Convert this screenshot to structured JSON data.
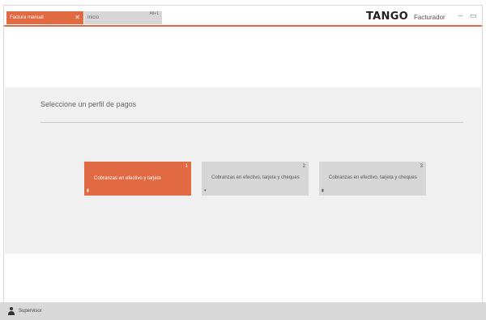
{
  "tabs": [
    {
      "label": "Factura manual",
      "close": "✕"
    },
    {
      "label": "Inicio",
      "shortcut": "Alt+1"
    }
  ],
  "header": {
    "brand": "TANGO",
    "app_name": "Facturador",
    "minimize": "–",
    "restore": "▭"
  },
  "colors": {
    "accent": "#e26a43",
    "panel": "#f0f0f0",
    "card_inactive": "#d6d6d6"
  },
  "main": {
    "title": "Seleccione un perfil de pagos",
    "cards": [
      {
        "number": "1",
        "label": "Cobranzas en efectivo y tarjeta",
        "mark": "▮"
      },
      {
        "number": "2",
        "label": "Cobranzas en efectivo, tarjeta y cheques",
        "mark": "▾"
      },
      {
        "number": "3",
        "label": "Cobranzas en efectivo, tarjeta y cheques",
        "mark": "▮"
      }
    ]
  },
  "status": {
    "user": "Supervisor"
  }
}
